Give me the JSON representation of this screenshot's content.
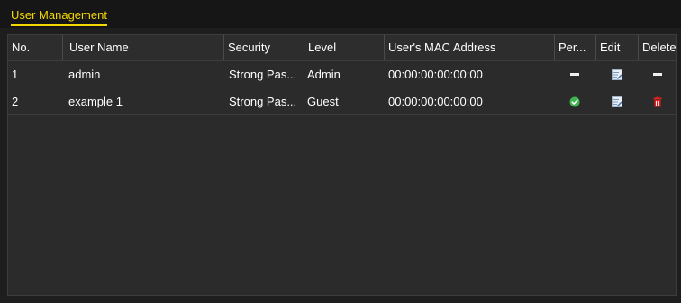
{
  "tab": {
    "label": "User Management"
  },
  "table": {
    "headers": {
      "no": "No.",
      "user_name": "User Name",
      "security": "Security",
      "level": "Level",
      "mac": "User's MAC Address",
      "permission": "Per...",
      "edit": "Edit",
      "delete": "Delete"
    },
    "rows": [
      {
        "no": "1",
        "user_name": "admin",
        "security": "Strong Pas...",
        "level": "Admin",
        "mac": "00:00:00:00:00:00",
        "permission_icon": "dash-icon",
        "edit_icon": "edit-icon",
        "delete_icon": "dash-icon"
      },
      {
        "no": "2",
        "user_name": "example 1",
        "security": "Strong Pas...",
        "level": "Guest",
        "mac": "00:00:00:00:00:00",
        "permission_icon": "check-icon",
        "edit_icon": "edit-icon",
        "delete_icon": "trash-icon"
      }
    ]
  },
  "colors": {
    "accent": "#f5d800",
    "background": "#1e1e1e",
    "panel": "#2b2b2b",
    "check": "#3fb34f",
    "delete": "#e0201b",
    "edit": "#6fa7d8"
  }
}
